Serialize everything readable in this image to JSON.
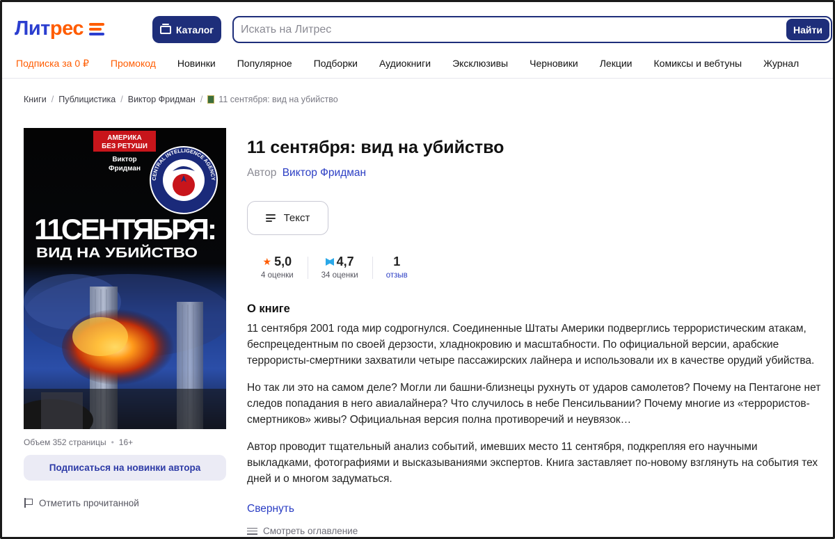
{
  "brand": {
    "logo_part1": "Лит",
    "logo_part2": "рес"
  },
  "header": {
    "catalog_label": "Каталог",
    "search_placeholder": "Искать на Литрес",
    "search_button": "Найти"
  },
  "nav": {
    "items": [
      {
        "label": "Подписка за 0 ₽",
        "accent": true
      },
      {
        "label": "Промокод",
        "accent": true
      },
      {
        "label": "Новинки"
      },
      {
        "label": "Популярное"
      },
      {
        "label": "Подборки"
      },
      {
        "label": "Аудиокниги"
      },
      {
        "label": "Эксклюзивы"
      },
      {
        "label": "Черновики"
      },
      {
        "label": "Лекции"
      },
      {
        "label": "Комиксы и вебтуны"
      },
      {
        "label": "Журнал"
      }
    ]
  },
  "breadcrumb": {
    "items": [
      "Книги",
      "Публицистика",
      "Виктор Фридман"
    ],
    "current": "11 сентября: вид на убийство"
  },
  "cover": {
    "badge_line1": "АМЕРИКА",
    "badge_line2": "БЕЗ РЕТУШИ",
    "author_line1": "Виктор",
    "author_line2": "Фридман",
    "seal_text": "CENTRAL INTELLIGENCE AGENCY",
    "title_big": "11СЕНТЯБРЯ:",
    "title_sub": "ВИД НА УБИЙСТВО"
  },
  "book": {
    "title": "11 сентября: вид на убийство",
    "author_label": "Автор",
    "author_name": "Виктор Фридман",
    "format_label": "Текст",
    "volume": "Объем 352 страницы",
    "age": "16+",
    "subscribe_label": "Подписаться на новинки автора",
    "mark_read_label": "Отметить прочитанной"
  },
  "ratings": {
    "litres": {
      "value": "5,0",
      "count": "4 оценки"
    },
    "livelib": {
      "value": "4,7",
      "count": "34 оценки"
    },
    "reviews": {
      "value": "1",
      "label": "отзыв"
    }
  },
  "about": {
    "title": "О книге",
    "paragraphs": [
      "11 сентября 2001 года мир содрогнулся. Соединенные Штаты Америки подверглись террористическим атакам, беспрецедентным по своей дерзости, хладнокровию и масштабности. По официальной версии, арабские террористы-смертники захватили четыре пассажирских лайнера и использовали их в качестве орудий убийства.",
      "Но так ли это на самом деле? Могли ли башни-близнецы рухнуть от ударов самолетов? Почему на Пентагоне нет следов попадания в него авиалайнера? Что случилось в небе Пенсильвании? Почему многие из «террористов-смертников» живы? Официальная версия полна противоречий и неувязок…",
      "Автор проводит тщательный анализ событий, имевших место 11 сентября, подкрепляя его научными выкладками, фотографиями и высказываниями экспертов. Книга заставляет по-новому взглянуть на события тех дней и о многом задуматься."
    ],
    "collapse_label": "Свернуть",
    "toc_label": "Смотреть оглавление"
  },
  "colors": {
    "brand_blue": "#1e2e7a",
    "brand_orange": "#ff5c00",
    "link_blue": "#2b3ec4"
  }
}
